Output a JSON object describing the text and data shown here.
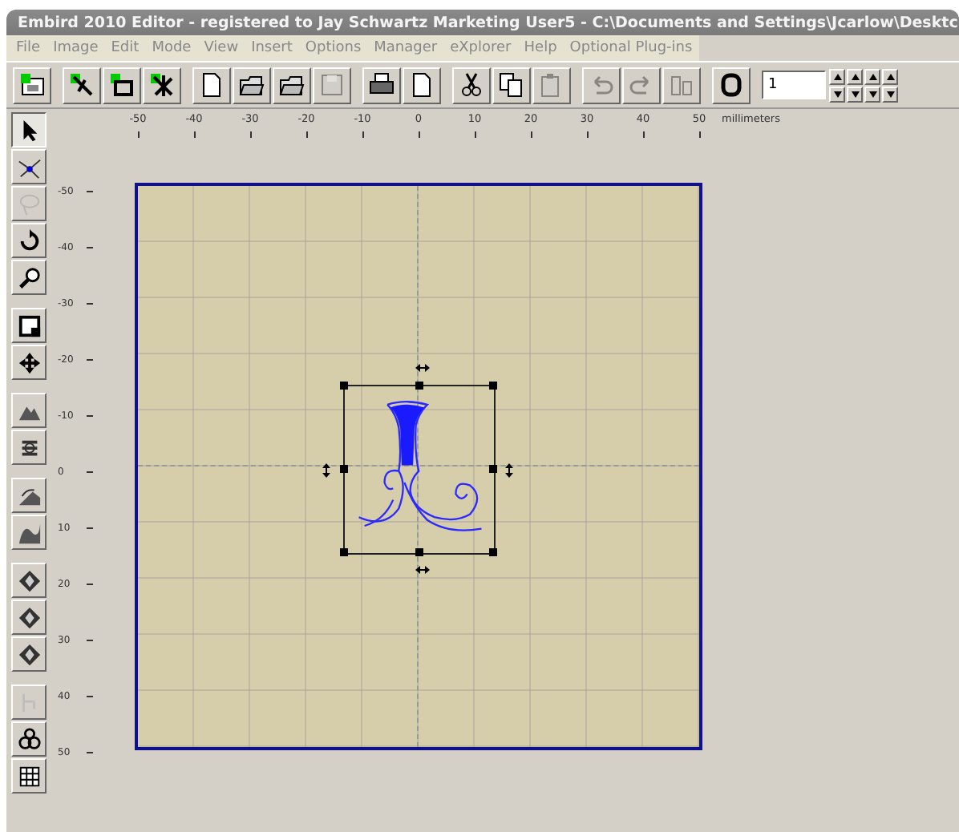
{
  "window": {
    "title": "Embird 2010 Editor - registered to Jay Schwartz Marketing User5 - C:\\Documents and Settings\\Jcarlow\\Desktc"
  },
  "menu": [
    "File",
    "Image",
    "Edit",
    "Mode",
    "View",
    "Insert",
    "Options",
    "Manager",
    "eXplorer",
    "Help",
    "Optional Plug-ins"
  ],
  "toolbar": [
    {
      "kind": "frame",
      "disabled": false
    },
    {
      "kind": "wand",
      "disabled": false
    },
    {
      "kind": "hoop",
      "disabled": false
    },
    {
      "kind": "wand-cross",
      "disabled": false
    },
    {
      "kind": "page",
      "disabled": false
    },
    {
      "kind": "folder",
      "disabled": false
    },
    {
      "kind": "folder",
      "disabled": false
    },
    {
      "kind": "disk",
      "disabled": true
    },
    {
      "kind": "printer",
      "disabled": false
    },
    {
      "kind": "page",
      "disabled": false
    },
    {
      "kind": "scissors",
      "disabled": false
    },
    {
      "kind": "copy",
      "disabled": false
    },
    {
      "kind": "paste",
      "disabled": true
    },
    {
      "kind": "undo",
      "disabled": true
    },
    {
      "kind": "redo",
      "disabled": true
    },
    {
      "kind": "split",
      "disabled": true
    },
    {
      "kind": "ring",
      "disabled": false
    }
  ],
  "count_field": {
    "value": "1"
  },
  "ruler": {
    "unit": "millimeters",
    "x_labels": [
      "-50",
      "-40",
      "-30",
      "-20",
      "-10",
      "0",
      "10",
      "20",
      "30",
      "40",
      "50"
    ],
    "y_labels": [
      "-50",
      "-40",
      "-30",
      "-20",
      "-10",
      "0",
      "10",
      "20",
      "30",
      "40",
      "50"
    ]
  },
  "tools": [
    {
      "kind": "arrow",
      "selected": true,
      "disabled": false
    },
    {
      "kind": "nodes",
      "selected": false,
      "disabled": false
    },
    {
      "kind": "lasso",
      "selected": false,
      "disabled": true
    },
    {
      "kind": "rotate",
      "selected": false,
      "disabled": false
    },
    {
      "kind": "magnifier",
      "selected": false,
      "disabled": false
    },
    {
      "kind": "crop",
      "selected": false,
      "disabled": false
    },
    {
      "kind": "move",
      "selected": false,
      "disabled": false
    },
    {
      "kind": "mountain",
      "selected": false,
      "disabled": false
    },
    {
      "kind": "stack",
      "selected": false,
      "disabled": false
    },
    {
      "kind": "slope",
      "selected": false,
      "disabled": false
    },
    {
      "kind": "wave",
      "selected": false,
      "disabled": false
    },
    {
      "kind": "diamond",
      "selected": false,
      "disabled": false
    },
    {
      "kind": "diamond",
      "selected": false,
      "disabled": false
    },
    {
      "kind": "diamond",
      "selected": false,
      "disabled": false
    },
    {
      "kind": "branch",
      "selected": false,
      "disabled": true
    },
    {
      "kind": "circles",
      "selected": false,
      "disabled": false
    },
    {
      "kind": "grid",
      "selected": false,
      "disabled": false
    }
  ],
  "design": {
    "selected": true
  }
}
